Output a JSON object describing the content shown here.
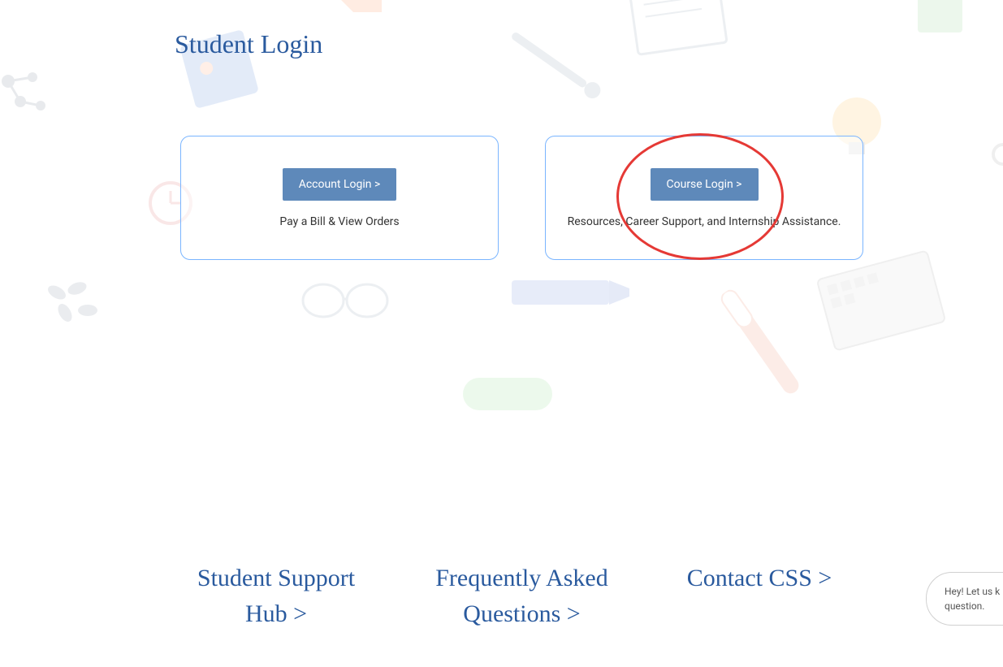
{
  "page": {
    "title": "Student Login"
  },
  "cards": {
    "account": {
      "button_label": "Account Login >",
      "description": "Pay a Bill & View Orders"
    },
    "course": {
      "button_label": "Course Login >",
      "description": "Resources, Career Support, and Internship Assistance."
    }
  },
  "bottom_links": {
    "support_hub": "Student Support Hub >",
    "faq": "Frequently Asked Questions >",
    "contact": "Contact CSS >"
  },
  "chat": {
    "message": "Hey! Let us k question."
  },
  "colors": {
    "primary_blue": "#2a5a9e",
    "button_blue": "#5e89ba",
    "border_blue": "#7ab5ff",
    "annotation_red": "#e53935"
  }
}
